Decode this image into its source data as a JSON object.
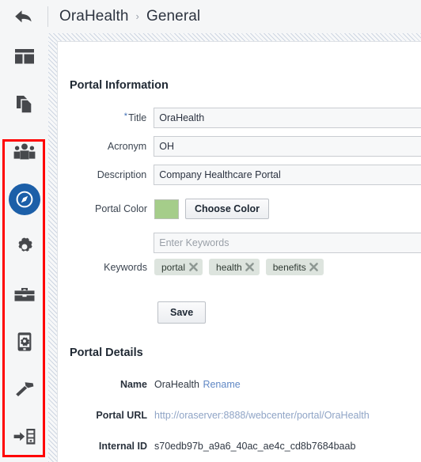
{
  "header": {
    "back_icon": "back-arrow-icon",
    "breadcrumb": {
      "portal": "OraHealth",
      "separator": "›",
      "page": "General"
    }
  },
  "sidebar": {
    "items": [
      {
        "name": "dashboard",
        "icon": "layout-dashboard-icon",
        "active": false
      },
      {
        "name": "pages",
        "icon": "documents-copy-icon",
        "active": false
      },
      {
        "name": "members",
        "icon": "people-group-icon",
        "active": false
      },
      {
        "name": "general",
        "icon": "compass-icon",
        "active": true
      },
      {
        "name": "settings",
        "icon": "gear-icon",
        "active": false
      },
      {
        "name": "tools",
        "icon": "toolbox-icon",
        "active": false
      },
      {
        "name": "device-settings",
        "icon": "mobile-gear-icon",
        "active": false
      },
      {
        "name": "assets",
        "icon": "hammer-icon",
        "active": false
      },
      {
        "name": "deploy",
        "icon": "server-import-icon",
        "active": false
      }
    ],
    "highlight_color": "#ff0000",
    "active_color": "#1c5fa8"
  },
  "main": {
    "portal_information": {
      "title": "Portal Information",
      "fields": {
        "title_label": "Title",
        "title_required_mark": "*",
        "title_value": "OraHealth",
        "acronym_label": "Acronym",
        "acronym_value": "OH",
        "description_label": "Description",
        "description_value": "Company Healthcare Portal",
        "portal_color_label": "Portal Color",
        "portal_color_value": "#a5cd8a",
        "choose_color_label": "Choose Color",
        "keywords_label": "Keywords",
        "keywords_placeholder": "Enter Keywords",
        "keywords_value": "",
        "keywords": [
          {
            "label": "portal",
            "remove_icon": "close-x-icon"
          },
          {
            "label": "health",
            "remove_icon": "close-x-icon"
          },
          {
            "label": "benefits",
            "remove_icon": "close-x-icon"
          }
        ]
      },
      "save_label": "Save"
    },
    "portal_details": {
      "title": "Portal Details",
      "name_label": "Name",
      "name_value": "OraHealth",
      "rename_label": "Rename",
      "portal_url_label": "Portal URL",
      "portal_url_value": "http://oraserver:8888/webcenter/portal/OraHealth",
      "internal_id_label": "Internal ID",
      "internal_id_value": "s70edb97b_a9a6_40ac_ae4c_cd8b7684baab"
    }
  }
}
